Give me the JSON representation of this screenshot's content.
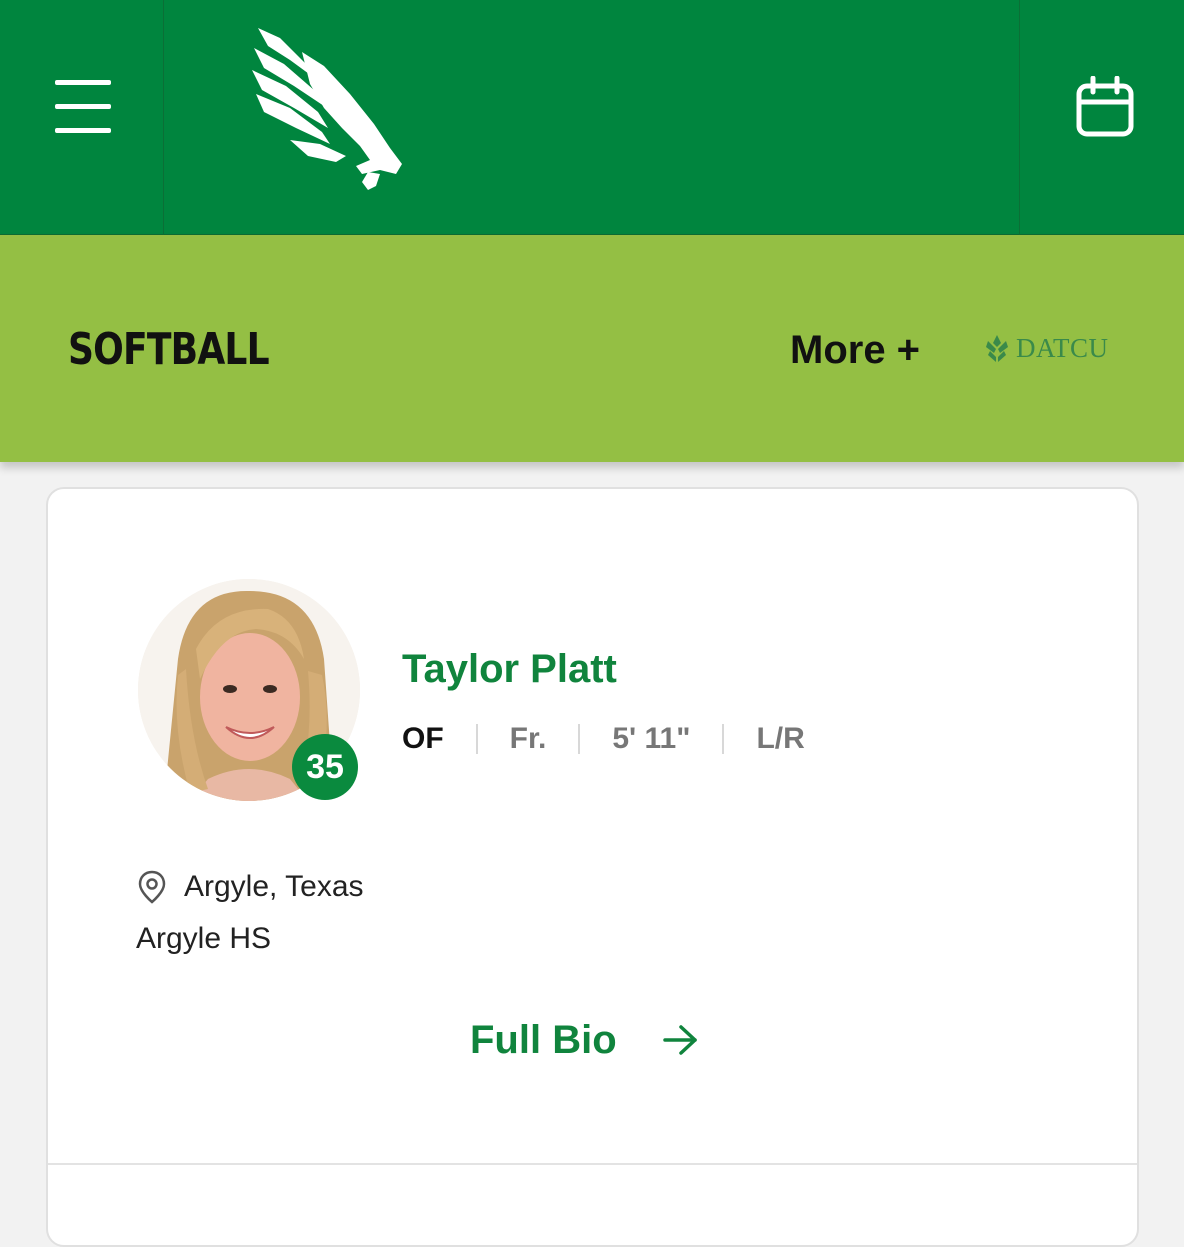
{
  "header": {
    "menu_icon": "hamburger-menu-icon",
    "logo_icon": "eagle-logo-icon",
    "calendar_icon": "calendar-icon",
    "brand_color": "#00853e"
  },
  "sport_bar": {
    "title": "SOFTBALL",
    "more_label": "More +",
    "sponsor_name": "DATCU",
    "bar_color": "#94bf44"
  },
  "player": {
    "name": "Taylor Platt",
    "jersey_number": "35",
    "position": "OF",
    "class_year": "Fr.",
    "height": "5' 11\"",
    "bats_throws": "L/R",
    "hometown": "Argyle, Texas",
    "high_school": "Argyle HS",
    "full_bio_label": "Full Bio",
    "accent_color": "#10843d"
  }
}
